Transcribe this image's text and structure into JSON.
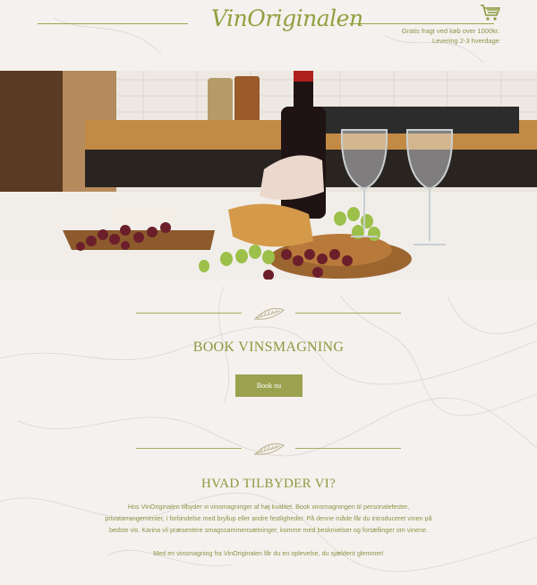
{
  "header": {
    "logo": "VinOriginalen",
    "cart_icon": "shopping-cart-icon",
    "shipping_line1": "Gratis fragt ved køb over 1000kr.",
    "shipping_line2": "Levering 2-3 hverdage"
  },
  "hero": {
    "image_description": "wine-tasting-table-photo"
  },
  "book": {
    "divider_icon": "feather-leaf-icon",
    "title": "BOOK VINSMAGNING",
    "button": "Book nu"
  },
  "offer": {
    "divider_icon": "feather-leaf-icon",
    "title": "HVAD TILBYDER VI?",
    "paragraph1_line1": "Hos VinOriginalen tilbyder vi vinsmagninger af høj kvalitet. Book vinsmagningen til personalefester,",
    "paragraph1_line2": "privatarrangementer, i forbindelse med bryllup eller andre festligheder. På denne måde får du introduceret vinen på",
    "paragraph1_line3": "bedste vis. Karina vil præsentere smagssammensætninger, komme med beskrivelser og fortællinger om vinene.",
    "paragraph2": "Med en vinsmagning fra VinOriginalen får du en oplevelse, du sjældent glemmer!"
  },
  "colors": {
    "accent": "#8a9a3e",
    "button": "#9aa24f",
    "background": "#f4f1ee"
  }
}
